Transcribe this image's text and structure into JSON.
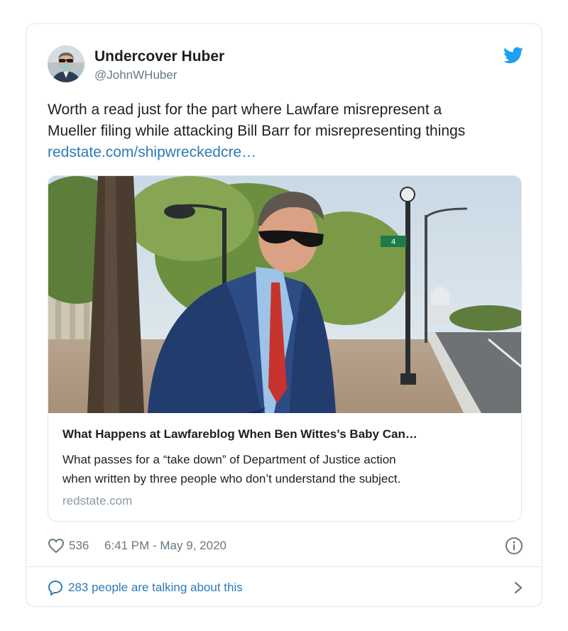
{
  "author": {
    "name": "Undercover Huber",
    "handle": "@JohnWHuber"
  },
  "tweet": {
    "text_line_1": "Worth a read just for the part where Lawfare misrepresent a",
    "text_line_2": "Mueller filing while attacking Bill Barr for misrepresenting things",
    "link": "redstate.com/shipwreckedcre…"
  },
  "card": {
    "title": "What Happens at Lawfareblog When Ben Wittes’s Baby Can…",
    "description_line_1": "What passes for a “take down” of Department of Justice action",
    "description_line_2": "when written by three people who don’t understand the subject.",
    "domain": "redstate.com",
    "street_sign": "4"
  },
  "meta": {
    "likes": "536",
    "timestamp": "6:41 PM - May 9, 2020"
  },
  "talk": {
    "text": "283 people are talking about this"
  },
  "icons": {
    "brand": "twitter-bird-icon",
    "like": "heart-icon",
    "info": "info-icon",
    "talk": "speech-bubble-icon",
    "chevron": "chevron-right-icon"
  },
  "colors": {
    "twitter_blue": "#1da1f2",
    "link_blue": "#2b7bb9",
    "text": "#1c2022",
    "muted": "#697882",
    "border": "#e1e8ed"
  }
}
